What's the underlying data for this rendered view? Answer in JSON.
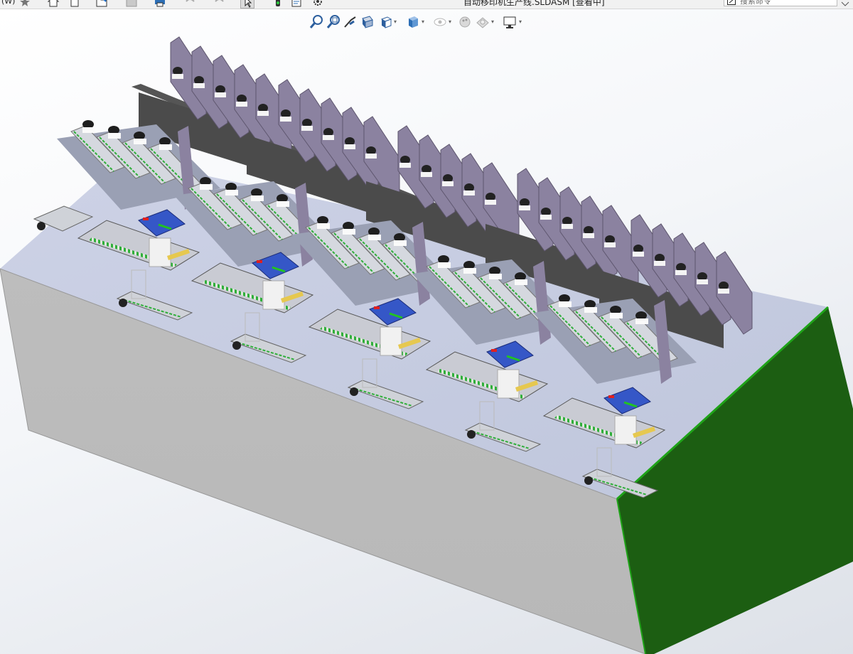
{
  "window": {
    "title": "自动移印机生产线.SLDASM [查看中]",
    "menu_fragment": "(W)",
    "search_placeholder": "搜索命令"
  },
  "toolbar": {
    "icons": [
      "pin-icon",
      "home-icon",
      "new-document-icon",
      "open-icon",
      "save-icon",
      "print-icon",
      "undo-icon",
      "redo-icon",
      "select-pointer-icon",
      "traffic-light-icon",
      "file-properties-icon",
      "options-gear-icon"
    ]
  },
  "view_toolbar": {
    "icons": [
      "zoom-to-fit-icon",
      "zoom-to-area-icon",
      "previous-view-icon",
      "section-view-icon",
      "view-orientation-icon",
      "display-style-icon",
      "hide-show-items-icon",
      "edit-appearance-icon",
      "apply-scene-icon",
      "view-settings-icon"
    ]
  },
  "model": {
    "description_colors": {
      "base_top": "#c7ccdf",
      "base_front": "#bdbdbd",
      "base_side": "#1c5e12",
      "side_edge": "#1fa318",
      "plate": "#8b82a0",
      "motor": "#3557c7"
    }
  }
}
